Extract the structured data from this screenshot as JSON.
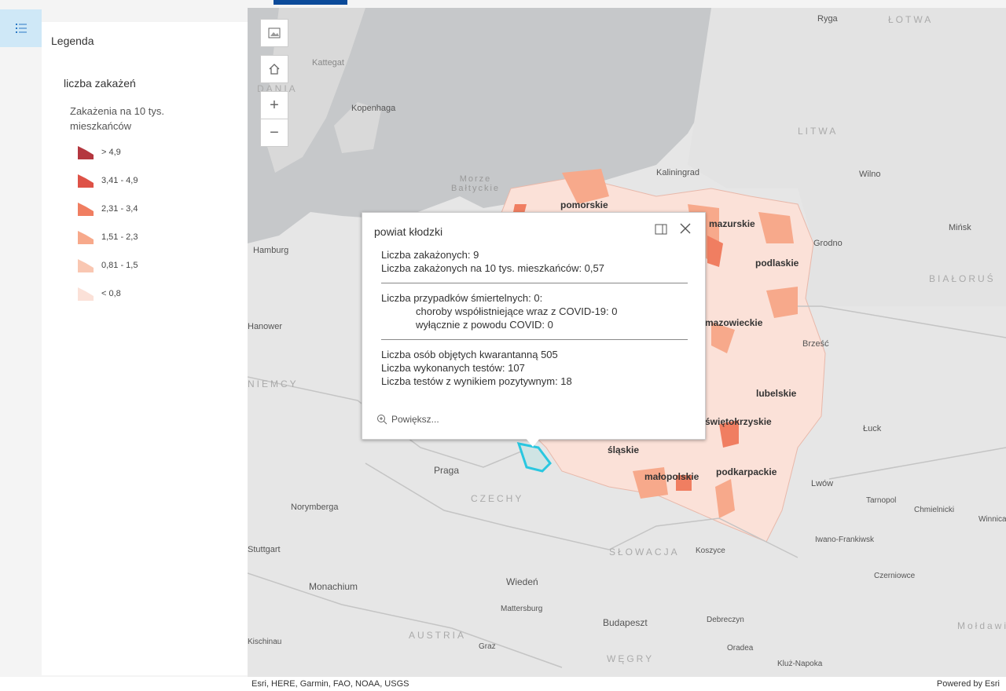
{
  "legend": {
    "title": "Legenda",
    "layer_name": "liczba zakażeń",
    "field_label": "Zakażenia na 10 tys. mieszkańców",
    "classes": [
      {
        "label": "> 4,9",
        "color": "#b4373f"
      },
      {
        "label": "3,41 - 4,9",
        "color": "#de5247"
      },
      {
        "label": "2,31 - 3,4",
        "color": "#f07e61"
      },
      {
        "label": "1,51 - 2,3",
        "color": "#f7a98b"
      },
      {
        "label": "0,81 - 1,5",
        "color": "#f9c7b2"
      },
      {
        "label": "< 0,8",
        "color": "#fbe1d8"
      }
    ]
  },
  "popup": {
    "title": "powiat kłodzki",
    "lines_a": [
      "Liczba zakażonych: 9",
      "Liczba zakażonych na 10 tys. mieszkańców: 0,57"
    ],
    "line_b1": "Liczba przypadków śmiertelnych: 0:",
    "line_b2": "choroby współistniejące wraz z COVID-19: 0",
    "line_b3": "wyłącznie z powodu COVID: 0",
    "lines_c": [
      "Liczba osób objętych kwarantanną 505",
      "Liczba wykonanych testów: 107",
      "Liczba testów z wynikiem pozytywnym: 18"
    ],
    "zoom_label": "Powiększ..."
  },
  "map": {
    "countries": [
      "ŁOTWA",
      "LITWA",
      "BIAŁORUŚ",
      "NIEMCY",
      "CZECHY",
      "SŁOWACJA",
      "AUSTRIA",
      "WĘGRY",
      "DANIA"
    ],
    "seas": [
      "Kattegat",
      "Morze Bałtyckie"
    ],
    "cities": [
      "Ryga",
      "Kopenhaga",
      "Kaliningrad",
      "Wilno",
      "Mińsk",
      "Hamburg",
      "Hanower",
      "Grodno",
      "Brześć",
      "Łuck",
      "Lwów",
      "Tarnopol",
      "Chmielnicki",
      "Winnica",
      "Iwano-Frankiwsk",
      "Czerniowce",
      "Praga",
      "Norymberga",
      "Monachium",
      "Wiedeń",
      "Mattersburg",
      "Koszyce",
      "Budapeszt",
      "Debreczyn",
      "Oradea",
      "Kluż-Napoka",
      "Graz",
      "Stuttgart",
      "Kischinau",
      "Mołdawia"
    ],
    "regions": [
      "pomorskie",
      "mazurskie",
      "podlaskie",
      "mazowieckie",
      "lubelskie",
      "świętokrzyskie",
      "śląskie",
      "małopolskie",
      "podkarpackie"
    ]
  },
  "attribution": {
    "left": "Esri, HERE, Garmin, FAO, NOAA, USGS",
    "right": "Powered by Esri"
  }
}
